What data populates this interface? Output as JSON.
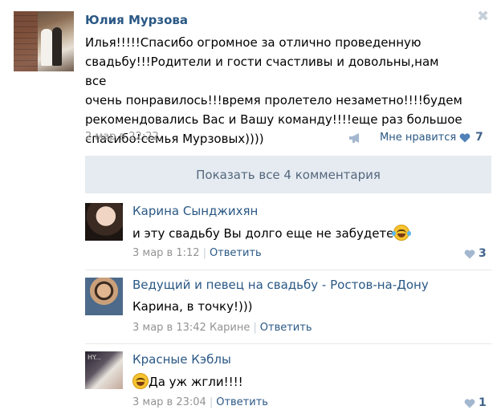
{
  "post": {
    "author": "Юлия Мурзова",
    "close_glyph": "✖",
    "text_lines": [
      "Илья!!!!!Спасибо огромное за отлично проведенную",
      "свадьбу!!!Родители и гости счастливы и довольны,нам все",
      "очень понравилось!!!время пролетело незаметно!!!!будем",
      "рекомендовались Вас и Вашу команду!!!!еще раз большое",
      "спасибо!семья Мурзовых))))"
    ],
    "date": "2 мар в 22:22",
    "like_label": "Мне нравится",
    "like_count": "7",
    "megaphone_icon": "megaphone-icon",
    "heart_icon": "heart-icon"
  },
  "show_all_label": "Показать все 4 комментария",
  "comments": [
    {
      "author": "Карина Сынджихян",
      "text": "и эту свадьбу Вы долго еще не забудете",
      "emoji": "joy-tears-emoji",
      "date": "3 мар в 1:12",
      "reply_to": "",
      "reply_label": "Ответить",
      "like_count": "3"
    },
    {
      "author": "Ведущий и певец на свадьбу - Ростов-на-Дону",
      "text": "Карина, в точку!)))",
      "date": "3 мар в 13:42",
      "reply_to": "Карине",
      "reply_label": "Ответить",
      "like_count": ""
    },
    {
      "author": "Красные Кэблы",
      "text": "Да уж жгли!!!!",
      "emoji": "laughing-emoji",
      "avatar_caption": "HY...",
      "date": "3 мар в 23:04",
      "reply_to": "",
      "reply_label": "Ответить",
      "like_count": "1"
    }
  ],
  "colors": {
    "link": "#2a5885",
    "muted": "#939393",
    "show_all_bg": "#e5ebf1",
    "heart": "#a3b7cf"
  }
}
